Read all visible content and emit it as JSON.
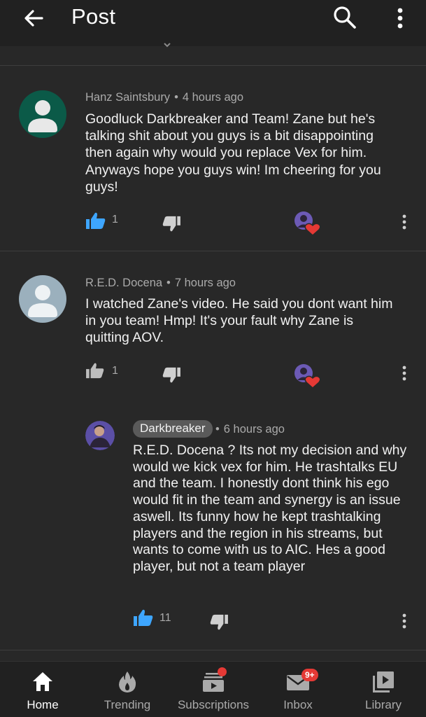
{
  "header": {
    "title": "Post"
  },
  "comments": [
    {
      "author": "Hanz Saintsbury",
      "time": "4 hours ago",
      "text": "Goodluck Darkbreaker and Team! Zane but he's talking shit about you guys is a bit disappointing then again why would you replace Vex for him. Anyways hope you guys win! Im cheering for you guys!",
      "likes": "1",
      "liked": true,
      "avatar_color": "#0b5a48",
      "hearted": true
    },
    {
      "author": "R.E.D. Docena",
      "time": "7 hours ago",
      "text": "I watched Zane's video. He said you dont want him in you team! Hmp! It's your fault why Zane is quitting AOV.",
      "likes": "1",
      "liked": false,
      "avatar_color": "#9bb0bd",
      "hearted": true
    }
  ],
  "reply": {
    "author": "Darkbreaker",
    "time": "6 hours ago",
    "text": "R.E.D. Docena ? Its not my decision and why would we kick vex for him. He trashtalks EU and the team. I honestly dont think his ego would fit in the team and synergy is an issue aswell. Its funny how he kept trashtalking players and the region in his streams, but wants to come with us to AIC. Hes a good player, but not a team player",
    "likes": "11",
    "liked": true
  },
  "colors": {
    "like_active": "#3ea6ff",
    "heart": "#e53935",
    "background": "#282828"
  },
  "bottom_nav": [
    {
      "label": "Home",
      "icon": "home-icon",
      "active": true
    },
    {
      "label": "Trending",
      "icon": "flame-icon",
      "active": false
    },
    {
      "label": "Subscriptions",
      "icon": "subscriptions-icon",
      "active": false
    },
    {
      "label": "Inbox",
      "icon": "inbox-icon",
      "active": false,
      "badge": "9+"
    },
    {
      "label": "Library",
      "icon": "library-icon",
      "active": false
    }
  ]
}
